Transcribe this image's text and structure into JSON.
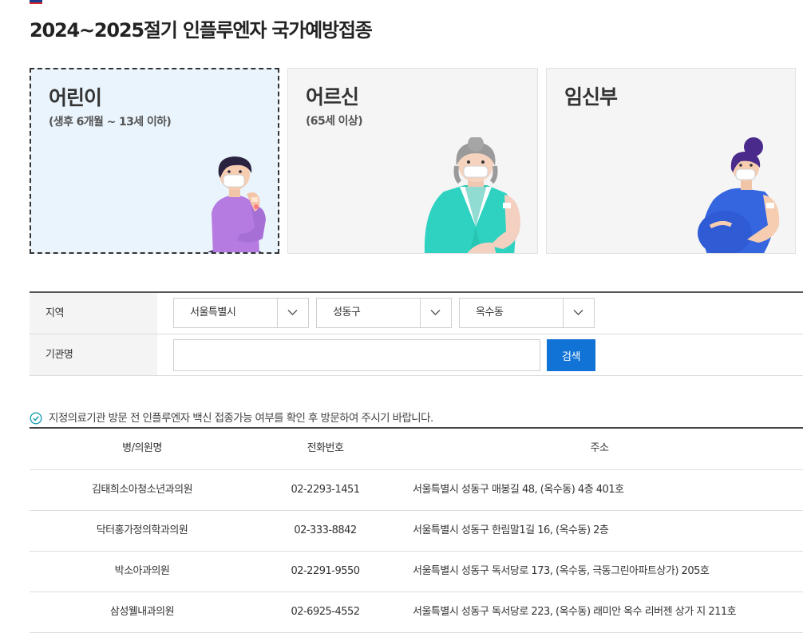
{
  "page": {
    "title": "2024~2025절기 인플루엔자 국가예방접종"
  },
  "groups": [
    {
      "title": "어린이",
      "subtitle": "(생후 6개월 ~ 13세 이하)",
      "selected": true
    },
    {
      "title": "어르신",
      "subtitle": "(65세 이상)",
      "selected": false
    },
    {
      "title": "임신부",
      "subtitle": "",
      "selected": false
    }
  ],
  "filter": {
    "region_label": "지역",
    "sido": "서울특별시",
    "sigungu": "성동구",
    "dong": "옥수동",
    "institution_label": "기관명",
    "institution_value": "",
    "search_button": "검색"
  },
  "notice": "지정의료기관 방문 전 인플루엔자 백신 접종가능 여부를 확인 후 방문하여 주시기 바랍니다.",
  "table": {
    "headers": [
      "병/의원명",
      "전화번호",
      "주소"
    ],
    "rows": [
      {
        "name": "김태희소아청소년과의원",
        "phone": "02-2293-1451",
        "address": "서울특별시 성동구 매봉길 48, (옥수동) 4층 401호"
      },
      {
        "name": "닥터홍가정의학과의원",
        "phone": "02-333-8842",
        "address": "서울특별시 성동구 한림말1길 16, (옥수동) 2층"
      },
      {
        "name": "박소아과의원",
        "phone": "02-2291-9550",
        "address": "서울특별시 성동구 독서당로 173, (옥수동, 극동그린아파트상가) 205호"
      },
      {
        "name": "삼성웰내과의원",
        "phone": "02-6925-4552",
        "address": "서울특별시 성동구 독서당로 223, (옥수동) 래미안 옥수 리버젠 상가 지 211호"
      }
    ]
  },
  "colors": {
    "accent": "#1273d6",
    "selected_card_bg": "#eaf4fc"
  }
}
